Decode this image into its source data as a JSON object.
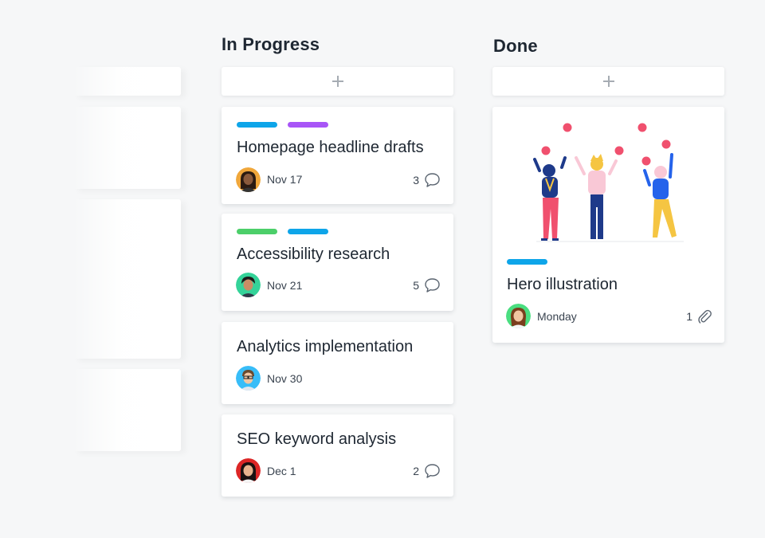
{
  "columns": [
    {
      "title": "In Progress",
      "cards": [
        {
          "title": "Homepage headline drafts",
          "tags": [
            "#0ea5e9",
            "#a855f7"
          ],
          "date": "Nov 17",
          "count": "3",
          "count_icon": "comment-icon"
        },
        {
          "title": "Accessibility research",
          "tags": [
            "#4ccf6a",
            "#0ea5e9"
          ],
          "date": "Nov 21",
          "count": "5",
          "count_icon": "comment-icon"
        },
        {
          "title": "Analytics implementation",
          "tags": [],
          "date": "Nov 30",
          "count": "",
          "count_icon": ""
        },
        {
          "title": "SEO keyword analysis",
          "tags": [],
          "date": "Dec 1",
          "count": "2",
          "count_icon": "comment-icon"
        }
      ]
    },
    {
      "title": "Done",
      "cards": [
        {
          "title": "Hero illustration",
          "tags": [
            "#0ea5e9"
          ],
          "date": "Monday",
          "count": "1",
          "count_icon": "paperclip-icon",
          "has_image": true
        }
      ]
    }
  ],
  "add_icon": "plus-icon",
  "colors": {
    "background": "#f6f7f8",
    "card": "#ffffff",
    "title": "#1e2732"
  }
}
